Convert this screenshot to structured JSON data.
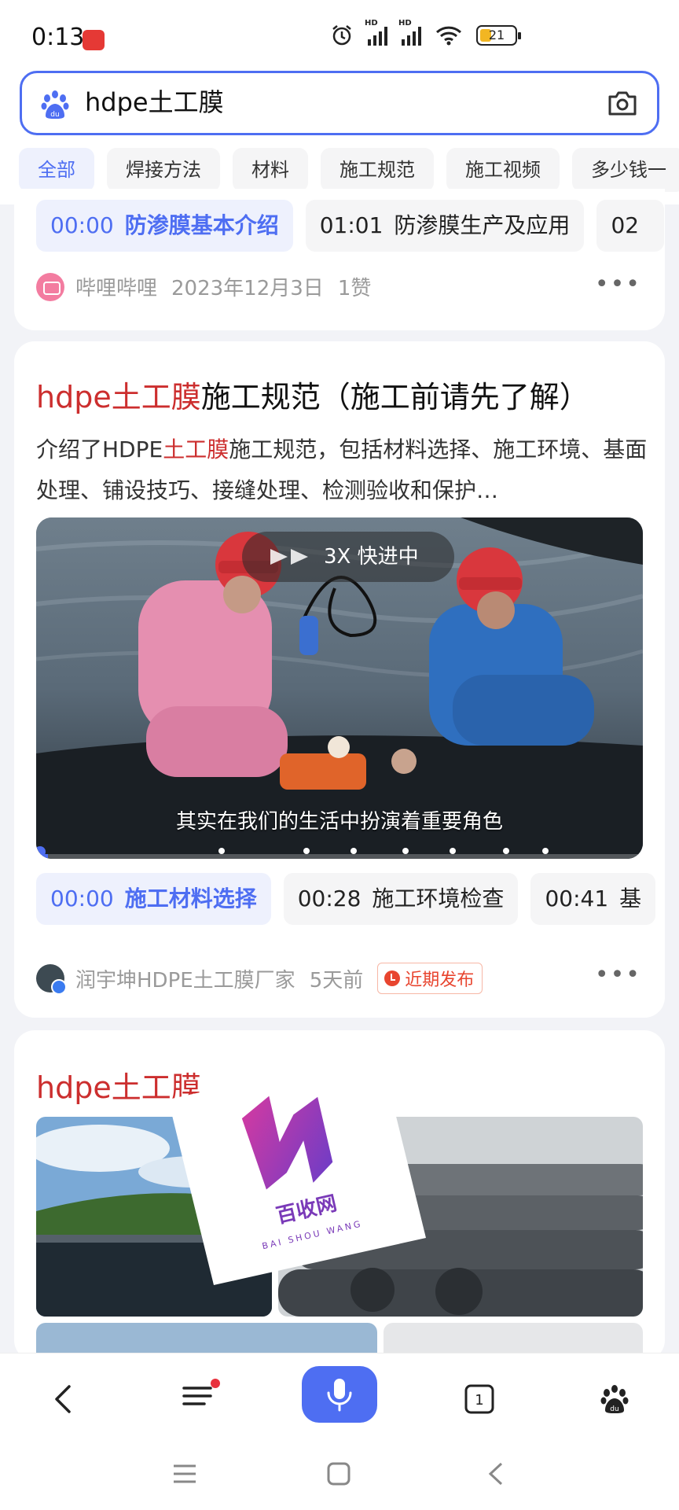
{
  "status_bar": {
    "time": "0:13",
    "app_badge": "小红书",
    "signal1_label": "HD",
    "signal2_label": "HD",
    "battery": "21"
  },
  "search": {
    "query": "hdpe土工膜",
    "tabs": [
      "全部",
      "焊接方法",
      "材料",
      "施工规范",
      "施工视频",
      "多少钱一"
    ]
  },
  "result1": {
    "chapters": [
      {
        "time": "00:00",
        "label": "防渗膜基本介绍"
      },
      {
        "time": "01:01",
        "label": "防渗膜生产及应用"
      },
      {
        "time": "02",
        "label": ""
      }
    ],
    "source": "哔哩哔哩",
    "date": "2023年12月3日",
    "likes": "1赞"
  },
  "result2": {
    "title_highlight": "hdpe土工膜",
    "title_rest": "施工规范（施工前请先了解）",
    "desc_pre": "介绍了HDPE",
    "desc_highlight": "土工膜",
    "desc_rest": "施工规范，包括材料选择、施工环境、基面处理、铺设技巧、接缝处理、检测验收和保护…",
    "video": {
      "speed_label": "3X  快进中",
      "subtitle": "其实在我们的生活中扮演着重要角色",
      "progress": 0.02
    },
    "chapters": [
      {
        "time": "00:00",
        "label": "施工材料选择"
      },
      {
        "time": "00:28",
        "label": "施工环境检查"
      },
      {
        "time": "00:41",
        "label": "基"
      }
    ],
    "source": "润宇坤HDPE土工膜厂家",
    "time_ago": "5天前",
    "badge": "近期发布"
  },
  "result3": {
    "title": "hdpe土工膜"
  },
  "watermark": {
    "title": "百收网",
    "subtitle": "BAI SHOU WANG"
  },
  "colors": {
    "accent": "#4e6ef2",
    "highlight": "#cc2e2e",
    "badge": "#e8452f"
  }
}
